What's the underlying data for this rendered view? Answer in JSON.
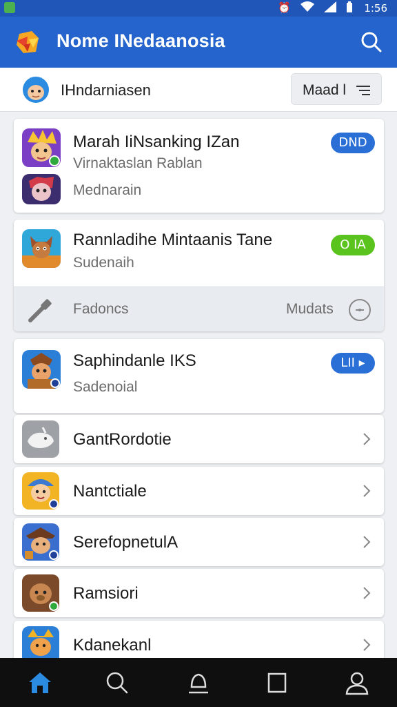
{
  "status_bar": {
    "time": "1:56",
    "icons": [
      "alarm-icon",
      "wifi-icon",
      "signal-icon",
      "battery-icon"
    ]
  },
  "app_bar": {
    "title": "Nome INedaanosia",
    "search_icon": "search-icon",
    "color": "#2464cc"
  },
  "user_bar": {
    "username": "IHndarniasen",
    "mode_button": "Maad l"
  },
  "cards": [
    {
      "title": "Marah IiNsanking IZan",
      "subtitle": "Virnaktaslan Rablan",
      "secondary": "Mednarain",
      "badge": "DND",
      "badge_color": "#2a6fd6"
    },
    {
      "title": "Rannladihe Mintaanis Tane",
      "subtitle": "Sudenaih",
      "badge": "O IA",
      "badge_color": "#5bc31e",
      "footer_left": "Fadoncs",
      "footer_right": "Mudats"
    },
    {
      "title": "Saphindanle IKS",
      "subtitle": "Sadenoial",
      "badge": "LII",
      "badge_color": "#2a6fd6"
    }
  ],
  "list_items": [
    {
      "label": "GantRordotie"
    },
    {
      "label": "Nantctiale"
    },
    {
      "label": "SerefopnetulA"
    },
    {
      "label": "Ramsiori"
    },
    {
      "label": "Kdanekanl"
    }
  ],
  "bottom_nav": [
    "home-icon",
    "search-icon",
    "notification-icon",
    "square-icon",
    "profile-icon"
  ]
}
